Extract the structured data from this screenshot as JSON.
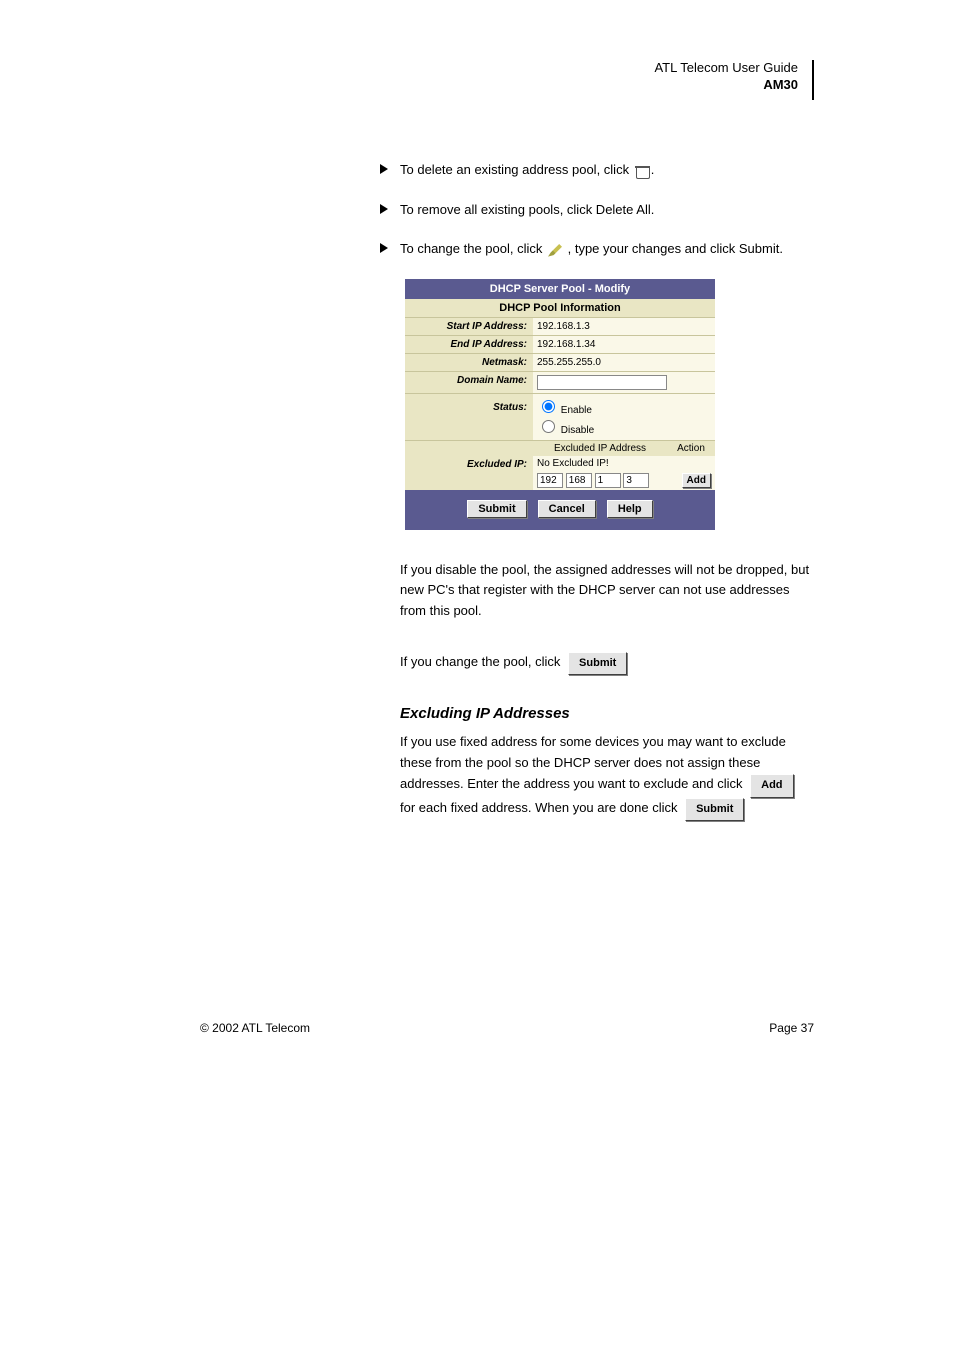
{
  "header": {
    "line1": "ATL Telecom User Guide",
    "line2": "AM30"
  },
  "bullets": [
    "To delete an existing address pool, click ",
    "To remove all existing pools, click Delete All.",
    "To change the pool, click "
  ],
  "bullet_tail": [
    ", type your changes and click Submit."
  ],
  "panel": {
    "title": "DHCP Server Pool - Modify",
    "subheader": "DHCP Pool Information",
    "labels": {
      "start": "Start IP Address:",
      "end": "End IP Address:",
      "netmask": "Netmask:",
      "domain": "Domain Name:",
      "status": "Status:",
      "excluded": "Excluded IP:"
    },
    "values": {
      "start": "192.168.1.3",
      "end": "192.168.1.34",
      "netmask": "255.255.255.0",
      "domain": ""
    },
    "status": {
      "enable": "Enable",
      "disable": "Disable",
      "selected": "enable"
    },
    "excluded": {
      "col1": "Excluded IP Address",
      "col2": "Action",
      "empty": "No Excluded IP!",
      "octets": [
        "192",
        "168",
        "1",
        "3"
      ],
      "add": "Add"
    },
    "buttons": {
      "submit": "Submit",
      "cancel": "Cancel",
      "help": "Help"
    }
  },
  "after1": {
    "p1": "If you disable the pool, the assigned addresses will not be dropped, but new PC's that register with the DHCP server can not use addresses from this pool.",
    "p2_1": "If you change the pool, click ",
    "p2_btn": "Submit",
    "p2_2": ""
  },
  "exclude_section": {
    "heading": "Excluding IP Addresses",
    "para_1": "If you use fixed address for some devices you may want to exclude these from the pool so the DHCP server does not assign these addresses. Enter the address you want to exclude and click ",
    "add_btn": "Add",
    "para_2": " for each fixed address. When you are done click ",
    "submit_btn": "Submit"
  },
  "footer": {
    "left": "© 2002 ATL Telecom",
    "right": "Page 37"
  }
}
